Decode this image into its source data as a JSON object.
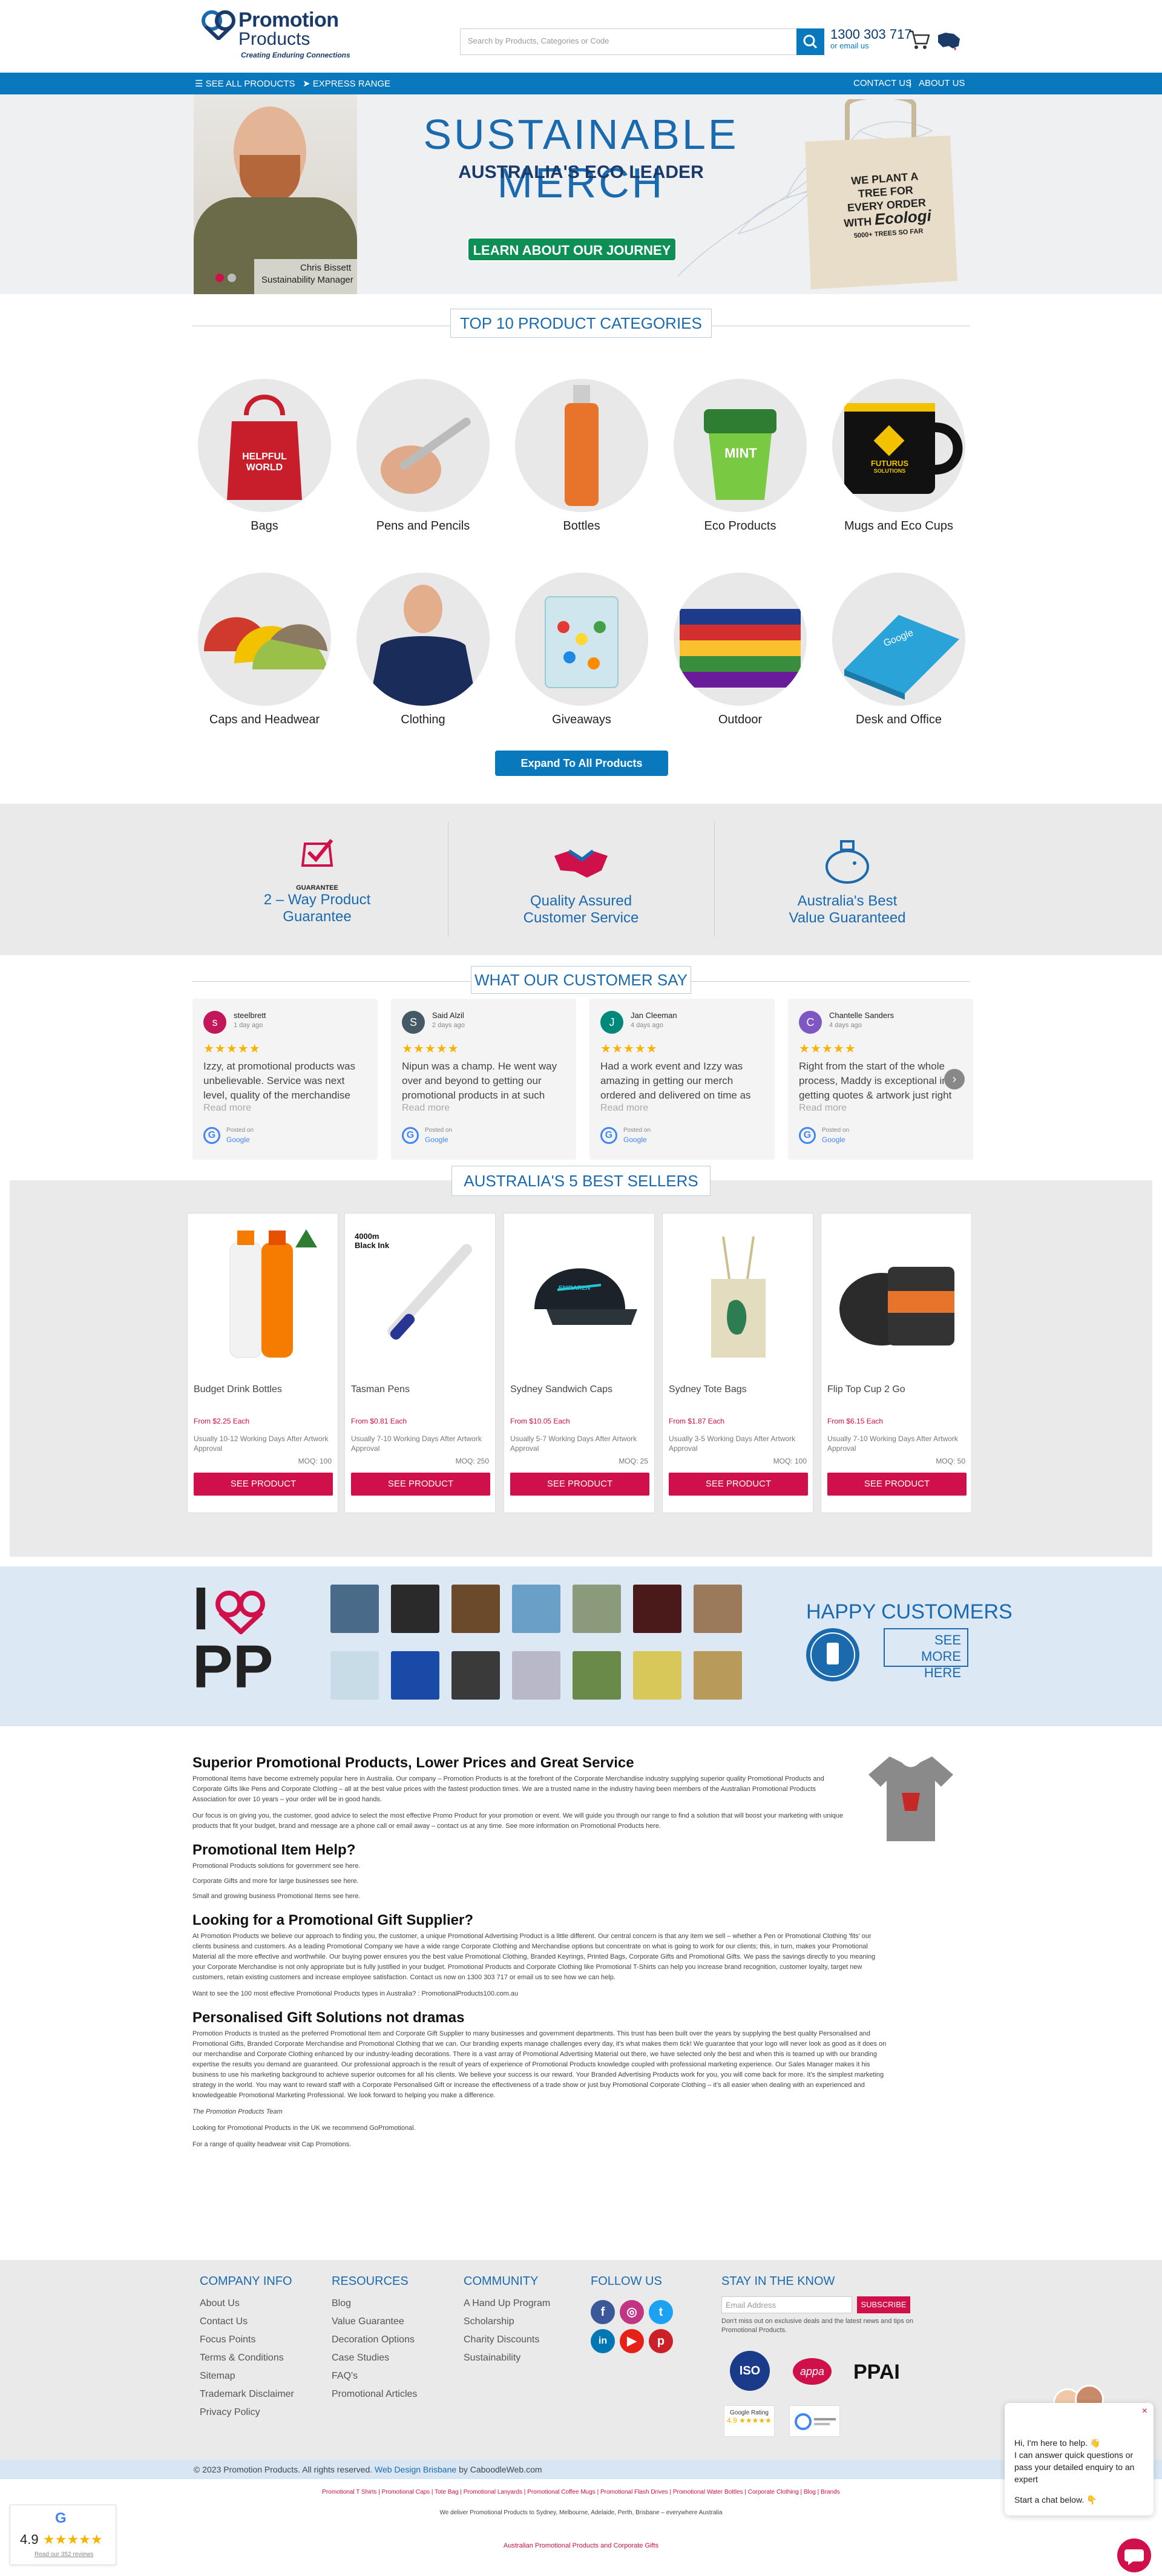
{
  "header": {
    "logo_line1": "Promotion",
    "logo_line2": "Products",
    "logo_tagline": "Creating Enduring Connections",
    "search_placeholder": "Search by Products, Categories or Code",
    "phone": "1300 303 717",
    "email_link": "or email us"
  },
  "nav": {
    "all_products": "SEE ALL PRODUCTS",
    "express": "EXPRESS RANGE",
    "contact": "CONTACT US",
    "sep": "|",
    "about": "ABOUT US"
  },
  "hero": {
    "title": "SUSTAINABLE MERCH",
    "subtitle": "AUSTRALIA'S ECO LEADER",
    "button": "LEARN ABOUT OUR JOURNEY",
    "person_name": "Chris Bissett",
    "person_role": "Sustainability Manager",
    "bag_line1": "WE PLANT A",
    "bag_line2": "TREE FOR",
    "bag_line3": "EVERY ORDER",
    "bag_line4": "WITH",
    "bag_brand": "Ecologi",
    "bag_line5": "5000+ TREES SO FAR"
  },
  "categories": {
    "title": "TOP 10 PRODUCT CATEGORIES",
    "items": [
      {
        "label": "Bags"
      },
      {
        "label": "Pens and Pencils"
      },
      {
        "label": "Bottles"
      },
      {
        "label": "Eco Products"
      },
      {
        "label": "Mugs and Eco Cups"
      },
      {
        "label": "Caps and Headwear"
      },
      {
        "label": "Clothing"
      },
      {
        "label": "Giveaways"
      },
      {
        "label": "Outdoor"
      },
      {
        "label": "Desk and Office"
      }
    ],
    "expand": "Expand To All Products Categories",
    "bag_print1": "HELPFUL",
    "bag_print2": "WORLD",
    "cup_print": "MINT",
    "mug_print1": "FUTURUS",
    "mug_print2": "SOLUTIONS",
    "notebook_print": "Google"
  },
  "why": {
    "item1_line1": "2 – Way Product",
    "item1_line2": "Guarantee",
    "item1_badge": "GUARANTEE",
    "item2_line1": "Quality Assured",
    "item2_line2": "Customer Service",
    "item3_line1": "Australia's Best",
    "item3_line2": "Value Guaranteed"
  },
  "reviews": {
    "title": "WHAT OUR CUSTOMER SAY",
    "stars": "★★★★★",
    "read_more": "Read more",
    "posted_on": "Posted on",
    "google": "Google",
    "items": [
      {
        "initial": "s",
        "name": "steelbrett",
        "date": "1 day ago",
        "text": "Izzy, at promotional products was unbelievable. Service was next level, quality of the merchandise was second",
        "color": "#c2185b"
      },
      {
        "initial": "S",
        "name": "Said Alzil",
        "date": "2 days ago",
        "text": "Nipun was a champ. He went way over and beyond to getting our promotional products in at such short notice. He",
        "color": "#455a64"
      },
      {
        "initial": "J",
        "name": "Jan Cleeman",
        "date": "4 days ago",
        "text": "Had a work event and Izzy was amazing in getting our merch ordered and delivered on time as we needed a",
        "color": "#00897b"
      },
      {
        "initial": "C",
        "name": "Chantelle Sanders",
        "date": "4 days ago",
        "text": "Right from the start of the whole process, Maddy is exceptional in getting quotes & artwork just right",
        "color": "#7e57c2"
      }
    ]
  },
  "best": {
    "title": "AUSTRALIA'S 5 BEST SELLERS",
    "button": "SEE PRODUCT",
    "from": "From",
    "pen_note1": "4000m",
    "pen_note2": "Black Ink",
    "cap_print": "ENIRAREN",
    "items": [
      {
        "name": "Budget Drink Bottles",
        "price": "$2.25 Each",
        "usually": "Usually 10-12 Working Days After Artwork Approval",
        "moq": "MOQ: 100"
      },
      {
        "name": "Tasman Pens",
        "price": "$0.81 Each",
        "usually": "Usually 7-10 Working Days After Artwork Approval",
        "moq": "MOQ: 250"
      },
      {
        "name": "Sydney Sandwich Caps",
        "price": "$10.05 Each",
        "usually": "Usually 5-7 Working Days After Artwork Approval",
        "moq": "MOQ: 25"
      },
      {
        "name": "Sydney Tote Bags",
        "price": "$1.87 Each",
        "usually": "Usually 3-5 Working Days After Artwork Approval",
        "moq": "MOQ: 100"
      },
      {
        "name": "Flip Top Cup 2 Go",
        "price": "$6.15 Each",
        "usually": "Usually 7-10 Working Days After Artwork Approval",
        "moq": "MOQ: 50"
      }
    ]
  },
  "happy": {
    "logo_top": "I",
    "logo_bottom": "PP",
    "title": "HAPPY CUSTOMERS",
    "link1": "SEE MORE",
    "link2": "HERE"
  },
  "content": {
    "h1": "Superior Promotional Products, Lower Prices and Great Service",
    "p1": "Promotional Items have become extremely popular here in Australia. Our company – Promotion Products is at the forefront of the Corporate Merchandise industry supplying superior quality Promotional Products and Corporate Gifts like Pens and Corporate Clothing – all at the best value prices with the fastest production times. We are a trusted name in the industry having been members of the Australian Promotional Products Association for over 10 years – your order will be in good hands.",
    "p2": "Our focus is on giving you, the customer, good advice to select the most effective Promo Product for your promotion or event. We will guide you through our range to find a solution that will boost your marketing with unique products that fit your budget, brand and message are a phone call or email away – contact us at any time. See more information on Promotional Products here.",
    "h2": "Promotional Item Help?",
    "l1": "Promotional Products solutions for government see here.",
    "l2": "Corporate Gifts and more for large businesses see here.",
    "l3": "Small and growing business Promotional Items see here.",
    "h3": "Looking for a Promotional Gift Supplier?",
    "p3": "At Promotion Products we believe our approach to finding you, the customer, a unique Promotional Advertising Product is a little different. Our central concern is that any item we sell – whether a Pen or Promotional Clothing 'fits' our clients business and customers. As a leading Promotional Company we have a wide range Corporate Clothing and Merchandise options but concentrate on what is going to work for our clients; this, in turn, makes your Promotional Material all the more effective and worthwhile. Our buying power ensures you the best value Promotional Clothing, Branded Keyrings, Printed Bags, Corporate Gifts and Promotional Gifts. We pass the savings directly to you meaning your Corporate Merchandise is not only appropriate but is fully justified in your budget. Promotional Products and Corporate Clothing like Promotional T-Shirts can help you increase brand recognition, customer loyalty, target new customers, retain existing customers and increase employee satisfaction. Contact us now on 1300 303 717 or email us to see how we can help.",
    "p4": "Want to see the 100 most effective Promotional Products types in Australia? : PromotionalProducts100.com.au",
    "h4": "Personalised Gift Solutions not dramas",
    "p5": "Promotion Products is trusted as the preferred Promotional Item and Corporate Gift Supplier to many businesses and government departments. This trust has been built over the years by supplying the best quality Personalised and Promotional Gifts, Branded Corporate Merchandise and Promotional Clothing that we can. Our branding experts manage challenges every day, it's what makes them tick! We guarantee that your logo will never look as good as it does on our merchandise and Corporate Clothing enhanced by our industry-leading decorations. There is a vast array of Promotional Advertising Material out there, we have selected only the best and when this is teamed up with our branding expertise the results you demand are guaranteed. Our professional approach is the result of years of experience of Promotional Products knowledge coupled with professional marketing experience. Our Sales Manager makes it his business to use his marketing background to achieve superior outcomes for all his clients. We believe your success is our reward. Your Branded Advertising Products work for you, you will come back for more. It's the simplest marketing strategy in the world. You may want to reward staff with a Corporate Personalised Gift or increase the effectiveness of a trade show or just buy Promotional Corporate Clothing – it's all easier when dealing with an experienced and knowledgeable Promotional Marketing Professional. We look forward to helping you make a difference.",
    "p6": "The Promotion Products Team",
    "p7": "Looking for Promotional Products in the UK we recommend GoPromotional.",
    "p8": "For a range of quality headwear visit Cap Promotions."
  },
  "footer": {
    "company": "COMPANY INFO",
    "company_links": [
      "About Us",
      "Contact Us",
      "Focus Points",
      "Terms & Conditions",
      "Sitemap",
      "Trademark Disclaimer",
      "Privacy Policy"
    ],
    "resources": "RESOURCES",
    "resources_links": [
      "Blog",
      "Value Guarantee",
      "Decoration Options",
      "Case Studies",
      "FAQ's",
      "Promotional Articles"
    ],
    "community": "COMMUNITY",
    "community_links": [
      "A Hand Up Program",
      "Scholarship",
      "Charity Discounts",
      "Sustainability"
    ],
    "follow": "FOLLOW US",
    "stay": "STAY IN THE KNOW",
    "email_placeholder": "Email Address",
    "subscribe": "SUBSCRIBE",
    "stay_note": "Don't miss out on exclusive deals and the latest news and tips on Promotional Products.",
    "iso": "ISO",
    "appa": "appa",
    "ppai": "PPAI",
    "google_rating": "Google Rating",
    "rating_value": "4.9",
    "copyright": "© 2023 Promotion Products. All rights reserved.",
    "web_design": "Web Design Brisbane",
    "by": "by CaboodleWeb.com",
    "links_line": "Promotional T Shirts | Promotional Caps | Tote Bag | Promotional Lanyards | Promotional Coffee Mugs | Promotional Flash Drives | Promotional Water Bottles | Corporate Clothing | Blog | Brands",
    "deliver": "We deliver Promotional Products to Sydney, Melbourne, Adelaide, Perth, Brisbane – everywhere Australia",
    "au_link": "Australian Promotional Products and Corporate Gifts"
  },
  "chat": {
    "line1": "Hi, I'm here to help. 👋",
    "line2": "I can answer quick questions or pass your detailed enquiry to an expert",
    "line3": "Start a chat below. 👇"
  },
  "google_badge": {
    "score": "4.9",
    "stars": "★★★★★",
    "label": "Read our 352 reviews"
  }
}
